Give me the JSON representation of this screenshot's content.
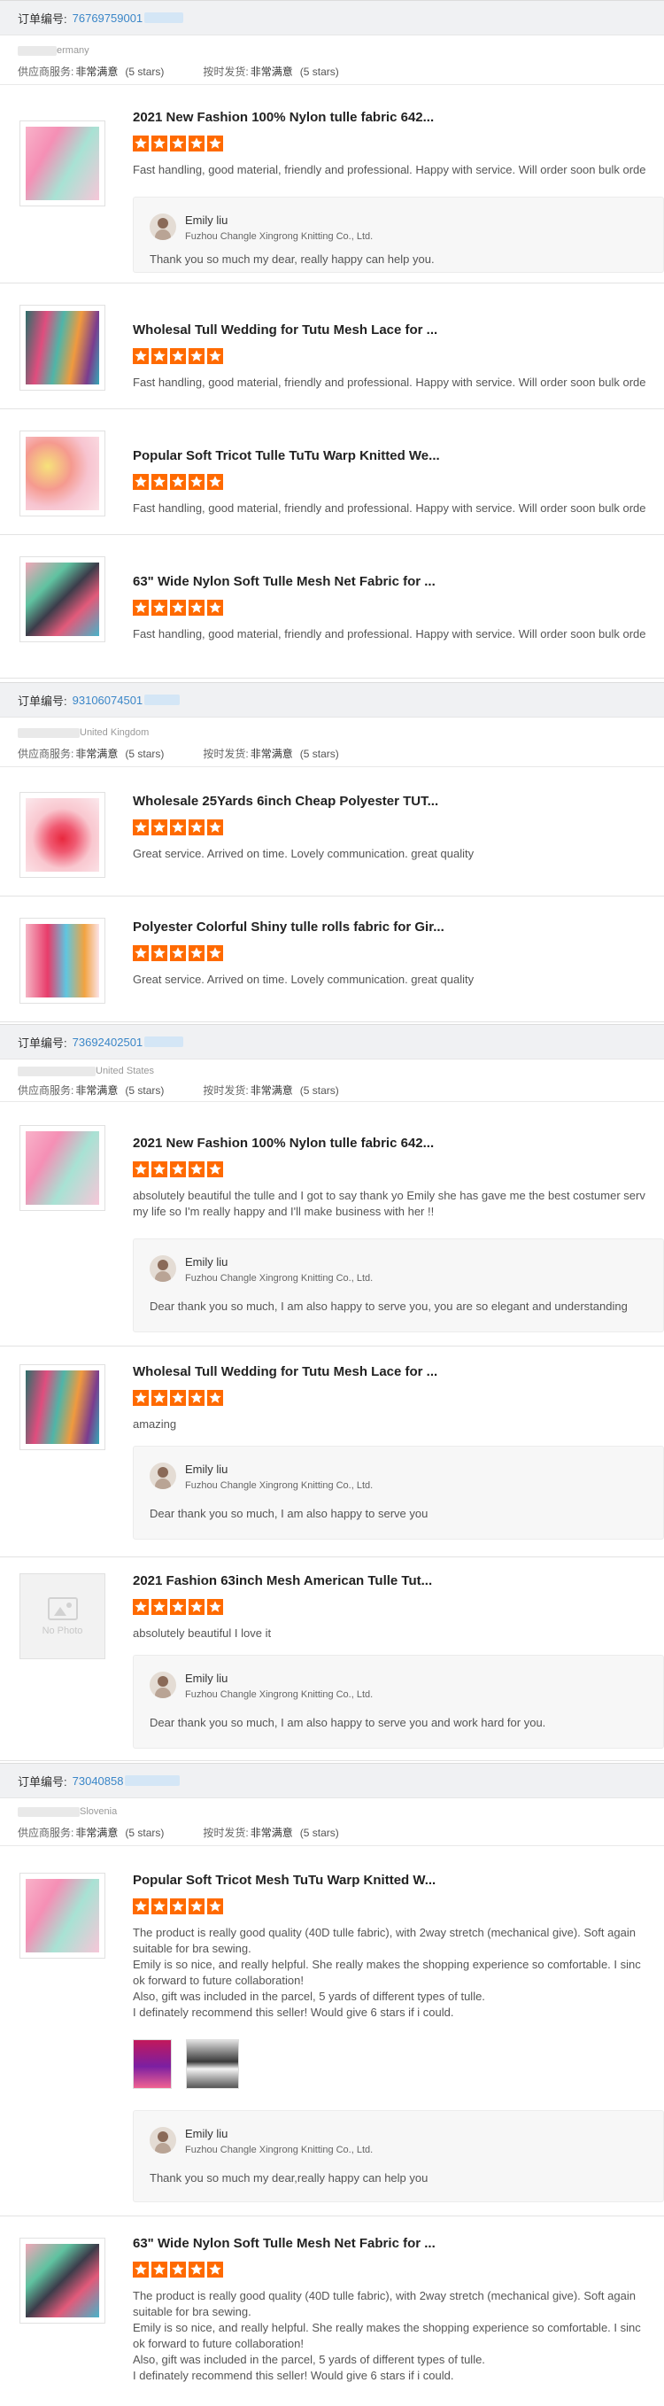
{
  "labels": {
    "order_no": "订单编号:",
    "supplier_service": "供应商服务:",
    "on_time": "按时发货:",
    "rating_value": "非常满意",
    "stars_note": "(5 stars)"
  },
  "colors": {
    "star": "#ff6a00",
    "order_link": "#3a86c8"
  },
  "orders": [
    {
      "order_id": "76769759001",
      "country": "ermany",
      "items": [
        {
          "title": "2021 New Fashion 100% Nylon tulle fabric 642...",
          "rating": 5,
          "review": "Fast handling, good material, friendly and professional. Happy with service. Will order soon bulk orde",
          "reply": {
            "name": "Emily liu",
            "company": "Fuzhou Changle Xingrong Knitting Co., Ltd.",
            "text": "Thank you so much my dear, really happy can help you."
          }
        },
        {
          "title": "Wholesal Tull Wedding for Tutu Mesh Lace for ...",
          "rating": 5,
          "review": "Fast handling, good material, friendly and professional. Happy with service. Will order soon bulk orde"
        },
        {
          "title": "Popular Soft Tricot Tulle TuTu Warp Knitted We...",
          "rating": 5,
          "review": "Fast handling, good material, friendly and professional. Happy with service. Will order soon bulk orde"
        },
        {
          "title": "63\" Wide Nylon Soft Tulle Mesh Net Fabric for ...",
          "rating": 5,
          "review": "Fast handling, good material, friendly and professional. Happy with service. Will order soon bulk orde"
        }
      ]
    },
    {
      "order_id": "93106074501",
      "country": "United Kingdom",
      "items": [
        {
          "title": "Wholesale 25Yards 6inch Cheap Polyester TUT...",
          "rating": 5,
          "review": "Great service.  Arrived on time.  Lovely communication.  great quality"
        },
        {
          "title": "Polyester Colorful Shiny tulle rolls fabric for Gir...",
          "rating": 5,
          "review": "Great service.  Arrived on time.  Lovely communication.  great quality"
        }
      ]
    },
    {
      "order_id": "73692402501",
      "country": "United States",
      "items": [
        {
          "title": "2021 New Fashion 100% Nylon tulle fabric 642...",
          "rating": 5,
          "review": "absolutely beautiful the tulle and I got to say thank yo Emily she has gave me the best costumer serv\nmy life so I'm really happy and I'll make business with her !!",
          "reply": {
            "name": "Emily liu",
            "company": "Fuzhou Changle Xingrong Knitting Co., Ltd.",
            "text": "Dear thank you so much, I am also happy to serve you, you are so elegant and understanding"
          }
        },
        {
          "title": "Wholesal Tull Wedding for Tutu Mesh Lace for ...",
          "rating": 5,
          "review": "amazing",
          "reply": {
            "name": "Emily liu",
            "company": "Fuzhou Changle Xingrong Knitting Co., Ltd.",
            "text": "Dear thank you so much, I am also happy to serve you"
          }
        },
        {
          "title": "2021 Fashion 63inch Mesh American Tulle Tut...",
          "rating": 5,
          "no_photo": "No Photo",
          "review": "absolutely beautiful I love it",
          "reply": {
            "name": "Emily liu",
            "company": "Fuzhou Changle Xingrong Knitting Co., Ltd.",
            "text": "Dear thank you so much, I am also happy to serve you and work hard for you."
          }
        }
      ]
    },
    {
      "order_id": "73040858",
      "country": "Slovenia",
      "items": [
        {
          "title": "Popular Soft Tricot Mesh TuTu Warp Knitted W...",
          "rating": 5,
          "review": "The product is really good quality (40D tulle fabric), with 2way stretch (mechanical give). Soft again\nsuitable for bra sewing.\nEmily is so nice, and really helpful. She really makes the shopping experience so comfortable. I sinc\nok forward to future collaboration!\nAlso, gift was included in the parcel, 5 yards of different types of tulle.\nI definately recommend this seller! Would give 6 stars if i could.",
          "reply": {
            "name": "Emily liu",
            "company": "Fuzhou Changle Xingrong Knitting Co., Ltd.",
            "text": "Thank you so much my dear,really happy can help you"
          }
        },
        {
          "title": "63\" Wide Nylon Soft Tulle Mesh Net Fabric for ...",
          "rating": 5,
          "review": "The product is really good quality (40D tulle fabric), with 2way stretch (mechanical give). Soft again\nsuitable for bra sewing.\nEmily is so nice, and really helpful. She really makes the shopping experience so comfortable. I sinc\nok forward to future collaboration!\nAlso, gift was included in the parcel, 5 yards of different types of tulle.\nI definately recommend this seller! Would give 6 stars if i could."
        }
      ]
    }
  ]
}
